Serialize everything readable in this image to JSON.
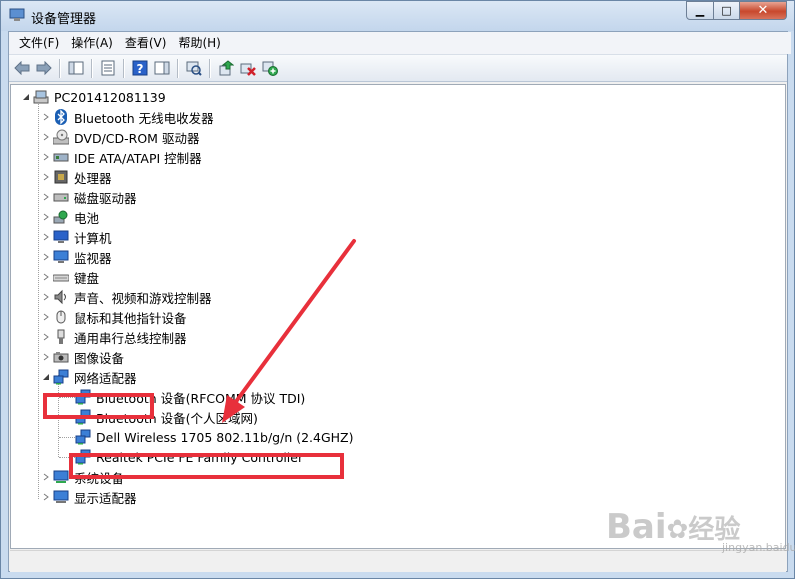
{
  "window": {
    "title": "设备管理器",
    "min_label": "▁",
    "max_label": "□",
    "close_label": "✕"
  },
  "menu": [
    "文件(F)",
    "操作(A)",
    "查看(V)",
    "帮助(H)"
  ],
  "tree": {
    "root": "PC201412081139",
    "categories": [
      {
        "label": "Bluetooth 无线电收发器",
        "icon": "bluetooth-icon"
      },
      {
        "label": "DVD/CD-ROM 驱动器",
        "icon": "dvd-drive-icon"
      },
      {
        "label": "IDE ATA/ATAPI 控制器",
        "icon": "ide-controller-icon"
      },
      {
        "label": "处理器",
        "icon": "processor-icon"
      },
      {
        "label": "磁盘驱动器",
        "icon": "disk-drive-icon"
      },
      {
        "label": "电池",
        "icon": "battery-icon"
      },
      {
        "label": "计算机",
        "icon": "computer-icon"
      },
      {
        "label": "监视器",
        "icon": "monitor-icon"
      },
      {
        "label": "键盘",
        "icon": "keyboard-icon"
      },
      {
        "label": "声音、视频和游戏控制器",
        "icon": "sound-icon"
      },
      {
        "label": "鼠标和其他指针设备",
        "icon": "mouse-icon"
      },
      {
        "label": "通用串行总线控制器",
        "icon": "usb-icon"
      },
      {
        "label": "图像设备",
        "icon": "imaging-icon"
      },
      {
        "label": "网络适配器",
        "icon": "network-adapter-icon",
        "expanded": true,
        "children": [
          "Bluetooth 设备(RFCOMM 协议 TDI)",
          "Bluetooth 设备(个人区域网)",
          "Dell Wireless 1705 802.11b/g/n (2.4GHZ)",
          "Realtek PCIe FE Family Controller"
        ]
      },
      {
        "label": "系统设备",
        "icon": "system-device-icon"
      },
      {
        "label": "显示适配器",
        "icon": "display-adapter-icon"
      }
    ]
  },
  "colors": {
    "highlight": "#e8303b",
    "arrow": "#e8303b"
  },
  "watermark": {
    "brand": "Bai",
    "brand2": "经验",
    "url": "jingyan.baidu.com"
  }
}
